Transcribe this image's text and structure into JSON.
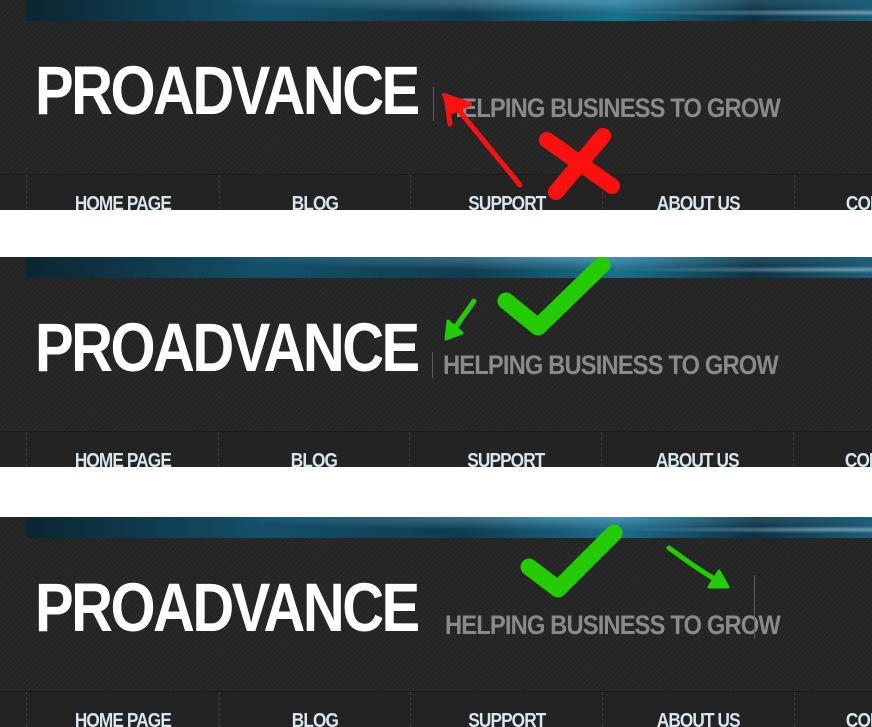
{
  "site": {
    "logo": "PROADVANCE",
    "tagline": "HELPING BUSINESS TO GROW"
  },
  "nav": {
    "items": [
      {
        "label": "HOME PAGE"
      },
      {
        "label": "BLOG"
      },
      {
        "label": "SUPPORT"
      },
      {
        "label": "ABOUT US"
      },
      {
        "label": "CON"
      }
    ]
  },
  "annotations": {
    "variant_1": "cross-mark",
    "variant_2": "check-mark",
    "variant_3": "check-mark"
  },
  "colors": {
    "background": "#262626",
    "logo": "#ffffff",
    "tagline": "#8a8a8a",
    "nav_text": "#d9e6ee",
    "banner_accent": "#14506a",
    "annotation_bad": "#ff0000",
    "annotation_good": "#22cc00",
    "separator_stripe": "#ffffff"
  }
}
